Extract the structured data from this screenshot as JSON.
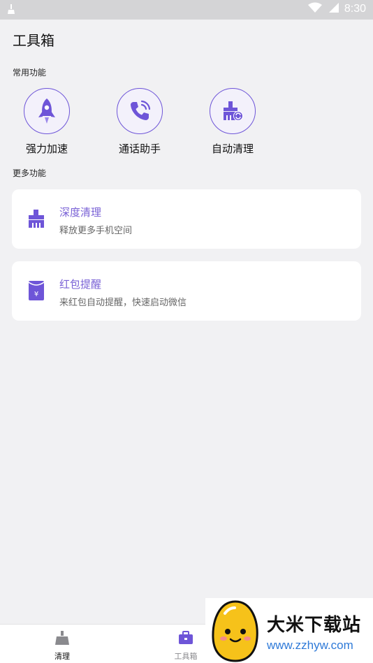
{
  "status_bar": {
    "time": "8:30"
  },
  "page": {
    "title": "工具箱"
  },
  "sections": {
    "common": "常用功能",
    "more": "更多功能"
  },
  "quick_tools": [
    {
      "label": "强力加速",
      "icon": "rocket-icon"
    },
    {
      "label": "通话助手",
      "icon": "phone-icon"
    },
    {
      "label": "自动清理",
      "icon": "auto-clean-icon"
    }
  ],
  "more_tools": [
    {
      "title": "深度清理",
      "subtitle": "释放更多手机空间",
      "icon": "broom-icon"
    },
    {
      "title": "红包提醒",
      "subtitle": "来红包自动提醒，快速启动微信",
      "icon": "red-envelope-icon"
    }
  ],
  "tabs": [
    {
      "label": "清理",
      "icon": "broom-tab-icon"
    },
    {
      "label": "工具箱",
      "icon": "toolbox-icon"
    }
  ],
  "watermark": {
    "text": "大米下载站",
    "url": "www.zzhyw.com"
  },
  "colors": {
    "accent": "#6e55d8",
    "accent_text": "#7a62d6",
    "background": "#f1f1f3"
  }
}
